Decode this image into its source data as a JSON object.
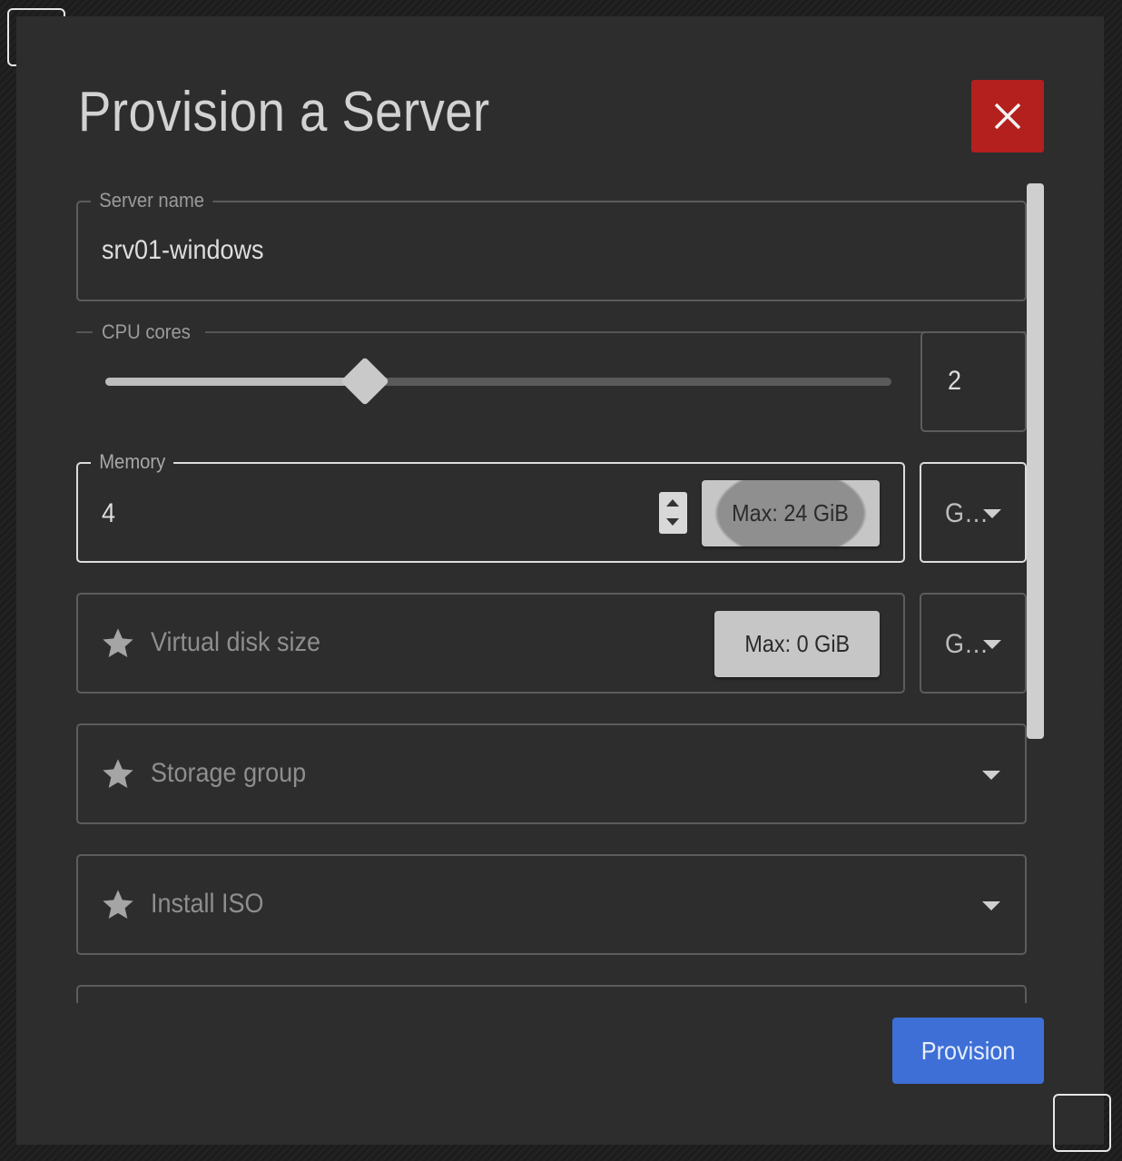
{
  "dialog": {
    "title": "Provision a Server",
    "close_icon": "close-icon"
  },
  "server_name": {
    "label": "Server name",
    "value": "srv01-windows"
  },
  "cpu": {
    "label": "CPU cores",
    "value": "2",
    "slider_fraction": 0.33
  },
  "memory": {
    "label": "Memory",
    "value": "4",
    "max_chip": "Max: 24 GiB",
    "unit": "G…"
  },
  "disk": {
    "placeholder": "Virtual disk size",
    "max_chip": "Max: 0 GiB",
    "unit": "G…",
    "icon": "star-icon"
  },
  "storage_group": {
    "placeholder": "Storage group",
    "icon": "star-icon"
  },
  "install_iso": {
    "placeholder": "Install ISO",
    "icon": "star-icon"
  },
  "actions": {
    "provision_label": "Provision"
  },
  "colors": {
    "close": "#b3201d",
    "primary": "#3d6fd6",
    "surface": "#2d2d2d"
  }
}
